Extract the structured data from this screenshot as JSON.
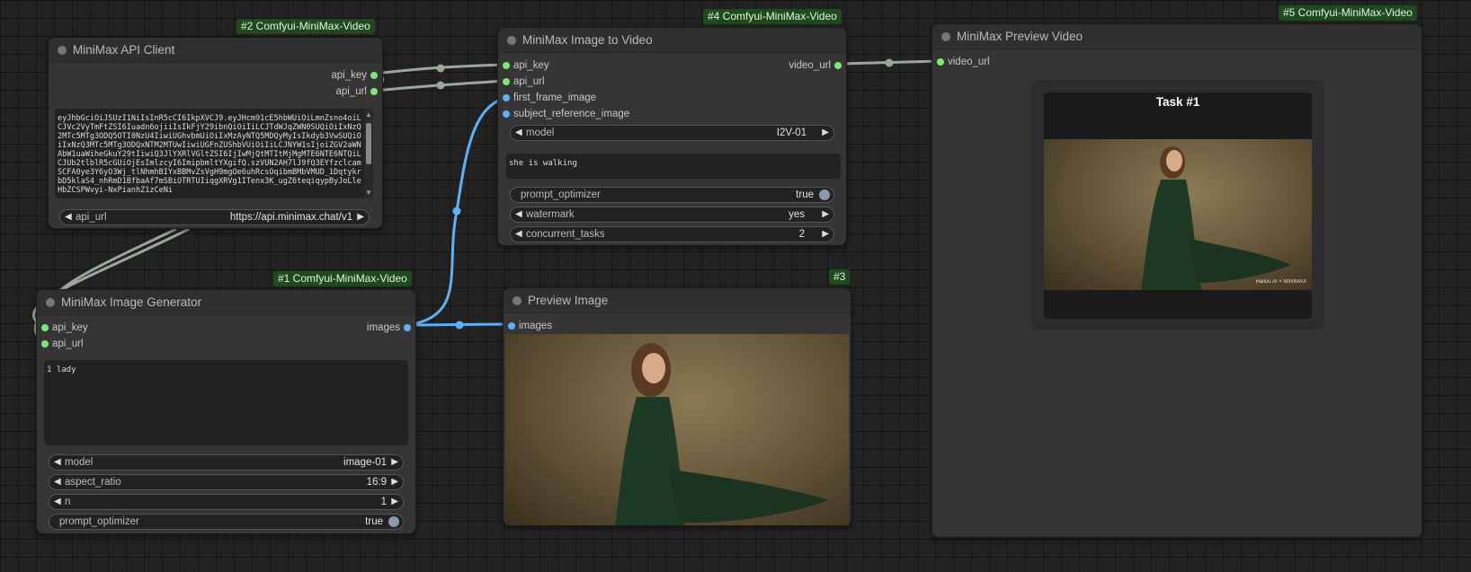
{
  "nodes": {
    "api_client": {
      "badge": "#2 Comfyui-MiniMax-Video",
      "title": "MiniMax API Client",
      "outputs": [
        "api_key",
        "api_url"
      ],
      "api_key_text": "eyJhbGciOiJSUzI1NiIsInR5cCI6IkpXVCJ9.eyJHcm91cE5hbWUiOiLmnZsno4oiLCJVc2VyTmFtZSI6Iuadn6ojiiIsIkFjY29ibnQiOiIiLCJTdWJqZWN0SUQiOiIxNzQ2MTc5MTg3ODQ5OTI0NzU4IiwiUGhvbmUiOiIxMzAyNTQ5MDQyMyIsIkdyb3VwSUQiOiIxNzQ3MTc5MTg3ODQxNTM2MTUwIiwiUGFnZUShbVUiOiIiLCJNYW1sIjoiZGV2aWNAbW1uaWiheGkuY29tIiwiQ3JlYXRlVGltZSI6IjIwMjQtMTItMjMgMTE6NTE6NTQiLCJUb2tlblR5cGUiOjEsImlzcyI6ImipbmltYXgifQ.szVUN2AH7lJ9fQ3EYfzclcamSCFA0ye3Y6yO3Wj_tlNhmhBIYxBBMvZsVgH9mgOe6uhRcsOqibmBMbVMUD_1DqtykrbD5klaS4_nhRmD1BfbaAf7mSBiOTRTUIiqgXRVg1ITenx3K_ugZ6teqiqypByJoLleHbZCSPWvyi-NxPianhZ1zCeNi",
      "api_url_label": "api_url",
      "api_url_value": "https://api.minimax.chat/v1"
    },
    "image_to_video": {
      "badge": "#4 Comfyui-MiniMax-Video",
      "title": "MiniMax Image to Video",
      "inputs": [
        "api_key",
        "api_url",
        "first_frame_image",
        "subject_reference_image"
      ],
      "output": "video_url",
      "model_label": "model",
      "model_value": "I2V-01",
      "prompt": "she is walking",
      "prompt_optimizer_label": "prompt_optimizer",
      "prompt_optimizer_value": "true",
      "watermark_label": "watermark",
      "watermark_value": "yes",
      "concurrent_label": "concurrent_tasks",
      "concurrent_value": "2"
    },
    "preview_video": {
      "badge": "#5 Comfyui-MiniMax-Video",
      "title": "MiniMax Preview Video",
      "input": "video_url",
      "task_title": "Task #1",
      "watermark_text": "Hailuo AI × MINIMAX"
    },
    "image_generator": {
      "badge": "#1 Comfyui-MiniMax-Video",
      "title": "MiniMax Image Generator",
      "inputs": [
        "api_key",
        "api_url"
      ],
      "output": "images",
      "prompt": "1 lady",
      "model_label": "model",
      "model_value": "image-01",
      "aspect_label": "aspect_ratio",
      "aspect_value": "16:9",
      "n_label": "n",
      "n_value": "1",
      "prompt_optimizer_label": "prompt_optimizer",
      "prompt_optimizer_value": "true"
    },
    "preview_image": {
      "badge": "#3",
      "title": "Preview Image",
      "input": "images"
    }
  },
  "colors": {
    "badge_bg": "#1e4a1e",
    "green_slot": "#7ae87a",
    "blue_slot": "#5fb1f5",
    "link_gray": "#9aa89a",
    "link_blue": "#5fb1f5"
  },
  "icons": {
    "dropdown_left": "◀",
    "dropdown_right": "▶",
    "scroll_up": "▲",
    "scroll_down": "▼"
  }
}
